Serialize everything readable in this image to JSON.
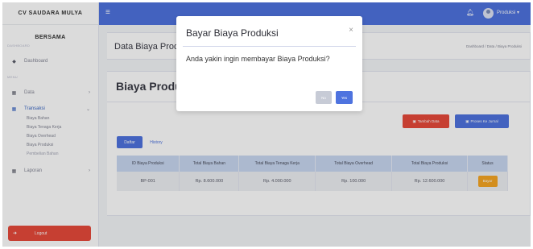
{
  "sidebar": {
    "brand": "CV SAUDARA MULYA",
    "user": "BERSAMA",
    "heading_main": "DASHBOARD",
    "dashboard": "Dashboard",
    "heading_menu": "MENU",
    "items": [
      {
        "label": "Data",
        "icon": "table-icon"
      },
      {
        "label": "Transaksi",
        "icon": "table-icon"
      }
    ],
    "sub_items": [
      "Biaya Bahan",
      "Biaya Tenaga Kerja",
      "Biaya Overhead",
      "Biaya Produksi",
      "Pembelian Bahan"
    ],
    "laporan": "Laporan",
    "logout": "Logout"
  },
  "topbar": {
    "user": "Produksi ▾"
  },
  "page": {
    "title": "Data Biaya Produksi",
    "breadcrumb": "Dashboard / Data / Biaya Produksi"
  },
  "main": {
    "section_title": "Biaya Produksi",
    "add_button": "Tambah Data",
    "process_button": "Proses Ke Jurnal",
    "tabs": [
      "Daftar",
      "History"
    ],
    "columns": [
      "ID Biaya Produksi",
      "Total Biaya Bahan",
      "Total Biaya Tenaga Kerja",
      "Total Biaya Overhead",
      "Total Biaya Produksi",
      "Status"
    ],
    "rows": [
      [
        "BP-001",
        "Rp. 8.600.000",
        "Rp. 4.000.000",
        "Rp. 100.000",
        "Rp. 12.600.000",
        "Bayar"
      ]
    ]
  },
  "modal": {
    "title": "Bayar Biaya Produksi",
    "close": "×",
    "message": "Anda yakin ingin membayar Biaya Produksi?",
    "no_label": "No",
    "yes_label": "Yes"
  },
  "colors": {
    "primary": "#4e73df",
    "danger": "#e74a3b",
    "warning": "#f6a623"
  }
}
